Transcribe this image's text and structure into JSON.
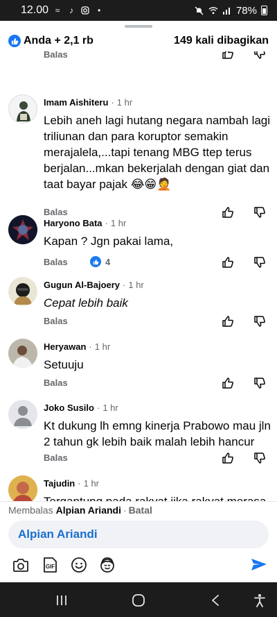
{
  "status_bar": {
    "time": "12.00",
    "battery": "78%"
  },
  "post": {
    "reactions_label": "Anda + 2,1 rb",
    "shares_label": "149 kali dibagikan"
  },
  "actions": {
    "reply_label": "Balas"
  },
  "comments": [
    {
      "author": "Imam Aishiteru",
      "time": "1 hr",
      "text": "Lebih aneh lagi hutang negara nambah lagi triliunan dan para koruptor semakin merajalela,...tapi tenang MBG ttep terus berjalan...mkan bekerjalah dengan giat dan taat bayar pajak 😂😁🤦",
      "italic": false
    },
    {
      "author": "Haryono Bata",
      "time": "1 hr",
      "text": "Kapan ? Jgn pakai lama,",
      "italic": false,
      "reaction_count": "4"
    },
    {
      "author": "Gugun Al-Bajoery",
      "time": "1 hr",
      "text": "Cepat lebih baik",
      "italic": true
    },
    {
      "author": "Heryawan",
      "time": "1 hr",
      "text": "Setuuju",
      "italic": false
    },
    {
      "author": "Joko Susilo",
      "time": "1 hr",
      "text": "Kt dukung lh emng kinerja Prabowo mau jln 2 tahun gk lebih baik malah lebih hancur",
      "italic": false
    },
    {
      "author": "Tajudin",
      "time": "1 hr",
      "text": "Tergantung pada rakyat jika rakyat merasa tdk puas dg kepemimpinan beliau bisa jadi",
      "italic": false
    }
  ],
  "reply": {
    "replying_prefix": "Membalas",
    "replying_to": "Alpian Ariandi",
    "cancel_label": "Batal",
    "input_value": "Alpian Ariandi"
  },
  "toolbar_icons": [
    "camera-icon",
    "gif-icon",
    "emoji-icon",
    "avatar-sticker-icon",
    "send-icon"
  ],
  "colors": {
    "accent": "#1877f2",
    "secondary_text": "#65676b",
    "input_bg": "#f0f2f5",
    "system_bar": "#1c1c1c"
  }
}
